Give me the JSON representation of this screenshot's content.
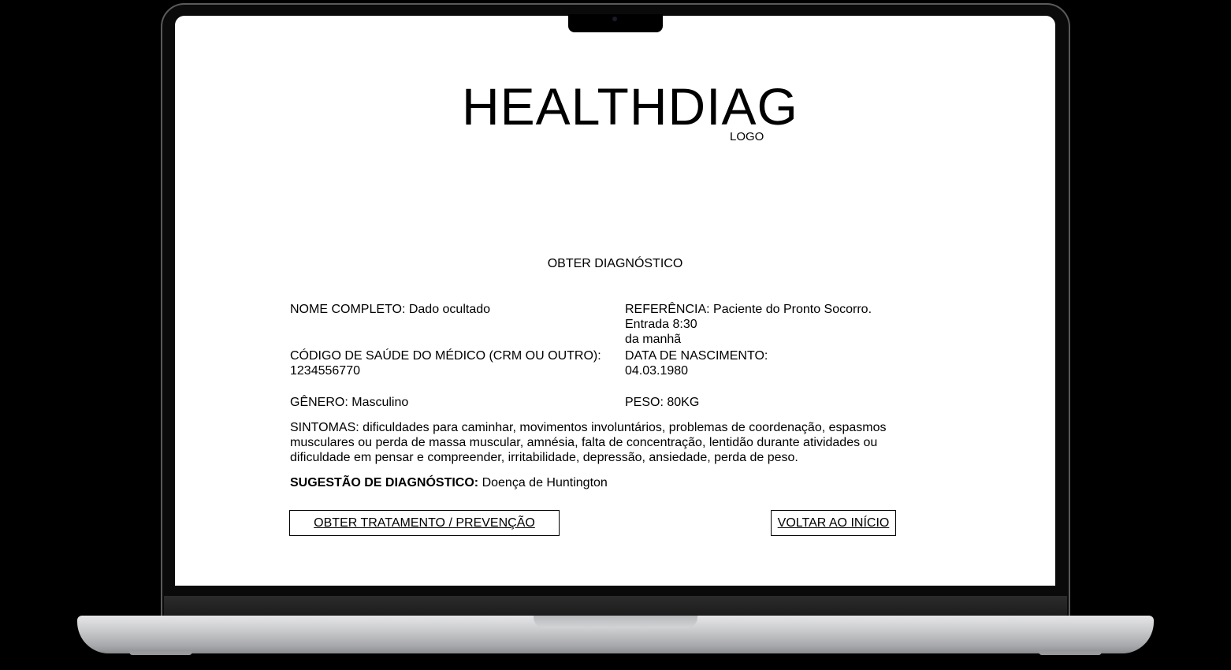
{
  "app": {
    "logo_text": "HEALTHDIAG",
    "logo_caption": "LOGO"
  },
  "page": {
    "heading": "OBTER DIAGNÓSTICO"
  },
  "patient": {
    "name": "NOME COMPLETO: Dado ocultado",
    "reference_line1": "REFERÊNCIA: Paciente do Pronto Socorro.",
    "reference_line2": "Entrada 8:30",
    "reference_line3": "da manhã",
    "doctor_code_label": "CÓDIGO DE SAÚDE DO MÉDICO (CRM OU OUTRO):",
    "doctor_code_value": "1234556770",
    "birth_label": "DATA DE NASCIMENTO:",
    "birth_value": "04.03.1980",
    "gender": "GÊNERO: Masculino",
    "weight": "PESO: 80KG",
    "symptoms": "SINTOMAS: dificuldades para caminhar, movimentos involuntários, problemas de coordenação, espasmos musculares ou perda de massa muscular, amnésia, falta de concentração, lentidão durante atividades ou dificuldade em pensar e compreender, irritabilidade, depressão, ansiedade, perda de peso."
  },
  "diagnosis": {
    "label": "SUGESTÃO DE DIAGNÓSTICO:",
    "value": "Doença de Huntington"
  },
  "actions": {
    "treatment_label": "OBTER TRATAMENTO / PREVENÇÃO",
    "home_label": "VOLTAR AO INÍCIO"
  }
}
